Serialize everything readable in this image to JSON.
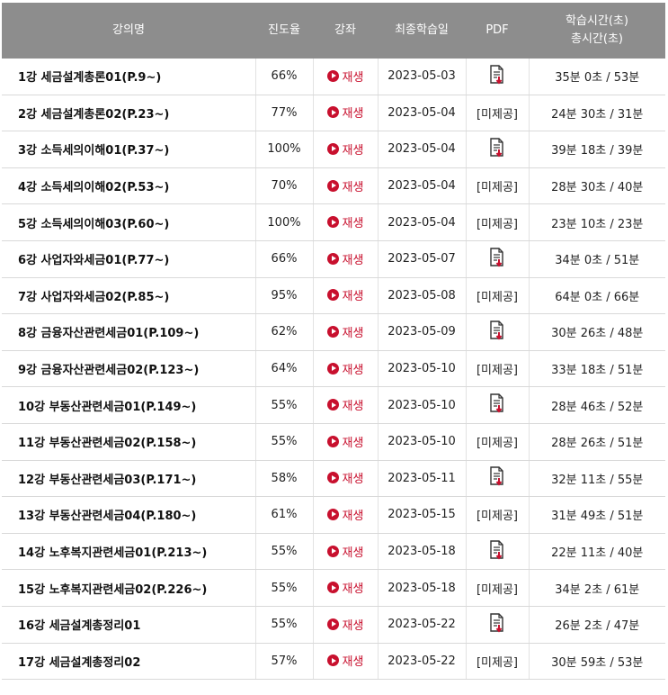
{
  "header": {
    "col_title": "강의명",
    "col_progress": "진도율",
    "col_lecture": "강좌",
    "col_last": "최종학습일",
    "col_pdf": "PDF",
    "col_time_line1": "학습시간(초)",
    "col_time_line2": "총시간(초)"
  },
  "labels": {
    "play": "재생",
    "no_pdf": "[미제공]"
  },
  "colors": {
    "header_bg": "#8d8d8d",
    "accent": "#c8102e"
  },
  "rows": [
    {
      "title": "1강 세금설계총론01(P.9~)",
      "progress": "66%",
      "date": "2023-05-03",
      "pdf": true,
      "time": "35분 0초 / 53분"
    },
    {
      "title": "2강 세금설계총론02(P.23~)",
      "progress": "77%",
      "date": "2023-05-04",
      "pdf": false,
      "time": "24분 30초 / 31분"
    },
    {
      "title": "3강 소득세의이해01(P.37~)",
      "progress": "100%",
      "date": "2023-05-04",
      "pdf": true,
      "time": "39분 18초 / 39분"
    },
    {
      "title": "4강 소득세의이해02(P.53~)",
      "progress": "70%",
      "date": "2023-05-04",
      "pdf": false,
      "time": "28분 30초 / 40분"
    },
    {
      "title": "5강 소득세의이해03(P.60~)",
      "progress": "100%",
      "date": "2023-05-04",
      "pdf": false,
      "time": "23분 10초 / 23분"
    },
    {
      "title": "6강 사업자와세금01(P.77~)",
      "progress": "66%",
      "date": "2023-05-07",
      "pdf": true,
      "time": "34분 0초 / 51분"
    },
    {
      "title": "7강 사업자와세금02(P.85~)",
      "progress": "95%",
      "date": "2023-05-08",
      "pdf": false,
      "time": "64분 0초 / 66분"
    },
    {
      "title": "8강 금융자산관련세금01(P.109~)",
      "progress": "62%",
      "date": "2023-05-09",
      "pdf": true,
      "time": "30분 26초 / 48분"
    },
    {
      "title": "9강 금융자산관련세금02(P.123~)",
      "progress": "64%",
      "date": "2023-05-10",
      "pdf": false,
      "time": "33분 18초 / 51분"
    },
    {
      "title": "10강 부동산관련세금01(P.149~)",
      "progress": "55%",
      "date": "2023-05-10",
      "pdf": true,
      "time": "28분 46초 / 52분"
    },
    {
      "title": "11강 부동산관련세금02(P.158~)",
      "progress": "55%",
      "date": "2023-05-10",
      "pdf": false,
      "time": "28분 26초 / 51분"
    },
    {
      "title": "12강 부동산관련세금03(P.171~)",
      "progress": "58%",
      "date": "2023-05-11",
      "pdf": true,
      "time": "32분 11초 / 55분"
    },
    {
      "title": "13강 부동산관련세금04(P.180~)",
      "progress": "61%",
      "date": "2023-05-15",
      "pdf": false,
      "time": "31분 49초 / 51분"
    },
    {
      "title": "14강 노후복지관련세금01(P.213~)",
      "progress": "55%",
      "date": "2023-05-18",
      "pdf": true,
      "time": "22분 11초 / 40분"
    },
    {
      "title": "15강 노후복지관련세금02(P.226~)",
      "progress": "55%",
      "date": "2023-05-18",
      "pdf": false,
      "time": "34분 2초 / 61분"
    },
    {
      "title": "16강 세금설계총정리01",
      "progress": "55%",
      "date": "2023-05-22",
      "pdf": true,
      "time": "26분 2초 / 47분"
    },
    {
      "title": "17강 세금설계총정리02",
      "progress": "57%",
      "date": "2023-05-22",
      "pdf": false,
      "time": "30분 59초 / 53분"
    }
  ]
}
